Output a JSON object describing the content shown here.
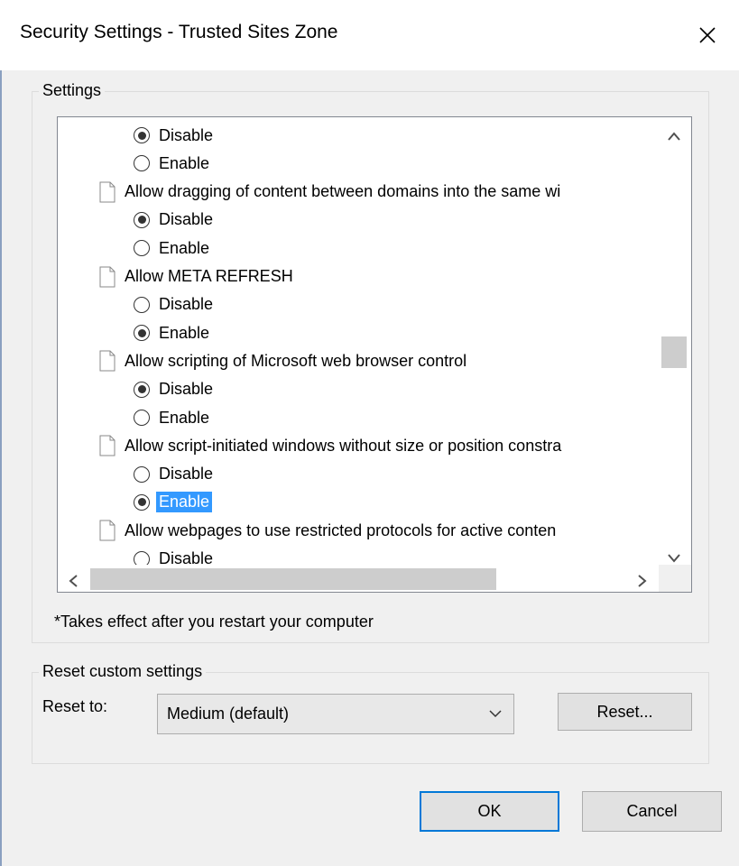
{
  "window": {
    "title": "Security Settings - Trusted Sites Zone"
  },
  "settings": {
    "group_label": "Settings",
    "rows": [
      {
        "kind": "radio",
        "label": "Disable",
        "checked": true
      },
      {
        "kind": "radio",
        "label": "Enable",
        "checked": false
      },
      {
        "kind": "heading",
        "label": "Allow dragging of content between domains into the same wi"
      },
      {
        "kind": "radio",
        "label": "Disable",
        "checked": true
      },
      {
        "kind": "radio",
        "label": "Enable",
        "checked": false
      },
      {
        "kind": "heading",
        "label": "Allow META REFRESH"
      },
      {
        "kind": "radio",
        "label": "Disable",
        "checked": false
      },
      {
        "kind": "radio",
        "label": "Enable",
        "checked": true
      },
      {
        "kind": "heading",
        "label": "Allow scripting of Microsoft web browser control"
      },
      {
        "kind": "radio",
        "label": "Disable",
        "checked": true
      },
      {
        "kind": "radio",
        "label": "Enable",
        "checked": false
      },
      {
        "kind": "heading",
        "label": "Allow script-initiated windows without size or position constra"
      },
      {
        "kind": "radio",
        "label": "Disable",
        "checked": false
      },
      {
        "kind": "radio",
        "label": "Enable",
        "checked": true,
        "selected": true
      },
      {
        "kind": "heading",
        "label": "Allow webpages to use restricted protocols for active conten"
      },
      {
        "kind": "radio",
        "label": "Disable",
        "checked": false
      }
    ],
    "note": "*Takes effect after you restart your computer"
  },
  "reset": {
    "group_label": "Reset custom settings",
    "reset_to_label": "Reset to:",
    "selected_level": "Medium (default)",
    "reset_button": "Reset..."
  },
  "buttons": {
    "ok": "OK",
    "cancel": "Cancel"
  },
  "colors": {
    "selection": "#3399ff",
    "default_button_border": "#0078d7"
  }
}
